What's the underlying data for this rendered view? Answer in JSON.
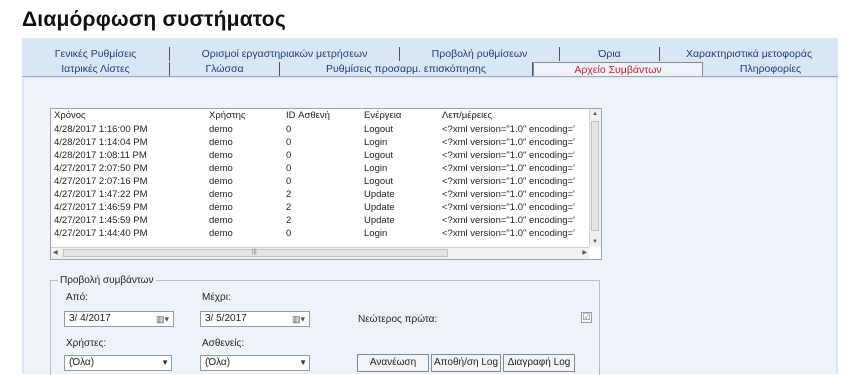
{
  "page_title": "Διαμόρφωση συστήματος",
  "tabs_row1": [
    "Γενικές Ρυθμίσεις",
    "Ορισμοί εργαστηριακών μετρήσεων",
    "Προβολή ρυθμίσεων",
    "Όρια",
    "Χαρακτηριστικά μετοφοράς"
  ],
  "tabs_row2": [
    "Ιατρικές Λίστες",
    "Γλώσσα",
    "Ρυθμίσεις προσαρμ. επισκόπησης",
    "Αρχείο Συμβάντων",
    "Πληροφορίες"
  ],
  "active_tab": "Αρχείο Συμβάντων",
  "log_table": {
    "columns": [
      "Χρόνος",
      "Χρήστης",
      "ID Ασθενή",
      "Ενέργεια",
      "Λεπ/μέρειες"
    ],
    "rows": [
      [
        "4/28/2017 1:16:00 PM",
        "demo",
        "0",
        "Logout",
        "<?xml version=\"1.0\" encoding='"
      ],
      [
        "4/28/2017 1:14:04 PM",
        "demo",
        "0",
        "Login",
        "<?xml version=\"1.0\" encoding='"
      ],
      [
        "4/28/2017 1:08:11 PM",
        "demo",
        "0",
        "Logout",
        "<?xml version=\"1.0\" encoding='"
      ],
      [
        "4/27/2017 2:07:50 PM",
        "demo",
        "0",
        "Login",
        "<?xml version=\"1.0\" encoding='"
      ],
      [
        "4/27/2017 2:07:16 PM",
        "demo",
        "0",
        "Logout",
        "<?xml version=\"1.0\" encoding='"
      ],
      [
        "4/27/2017 1:47:22 PM",
        "demo",
        "2",
        "Update",
        "<?xml version=\"1.0\" encoding='"
      ],
      [
        "4/27/2017 1:46:59 PM",
        "demo",
        "2",
        "Update",
        "<?xml version=\"1.0\" encoding='"
      ],
      [
        "4/27/2017 1:45:59 PM",
        "demo",
        "2",
        "Update",
        "<?xml version=\"1.0\" encoding='"
      ],
      [
        "4/27/2017 1:44:40 PM",
        "demo",
        "0",
        "Login",
        "<?xml version=\"1.0\" encoding='"
      ]
    ]
  },
  "view_events": {
    "legend": "Προβολή συμβάντων",
    "from_label": "Από:",
    "from_value": "3/ 4/2017",
    "to_label": "Μέχρι:",
    "to_value": "3/ 5/2017",
    "newest_first_label": "Νεώτερος πρώτα:",
    "newest_first_mark": "☑",
    "users_label": "Χρήστες:",
    "users_value": "(Όλα)",
    "patients_label": "Ασθενείς:",
    "patients_value": "(Όλα)",
    "refresh_button": "Ανανέωση",
    "save_log_button": "Αποθή/ση Log",
    "delete_log_button": "Διαγραφή Log"
  },
  "icons": {
    "calendar": "calendar-icon",
    "dropdown": "chevron-down-icon",
    "scroll_up": "arrow-up-icon",
    "scroll_down": "arrow-down-icon",
    "scroll_left": "arrow-left-icon",
    "scroll_right": "arrow-right-icon"
  },
  "colors": {
    "panel_bg": "#d9e6f5",
    "tab_text": "#1f3b73",
    "active_tab_text": "#cc2222"
  }
}
